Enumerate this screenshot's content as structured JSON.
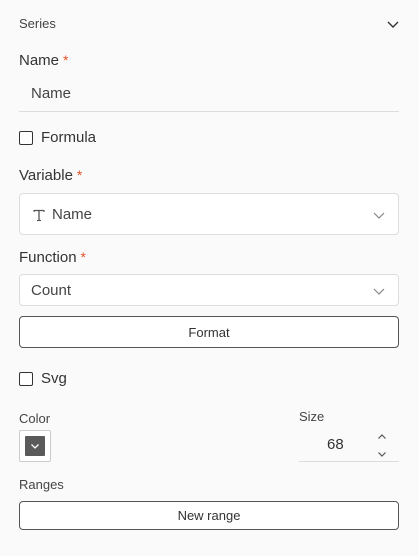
{
  "section": {
    "title": "Series"
  },
  "name": {
    "label": "Name",
    "required_mark": "*",
    "value": "Name"
  },
  "formula": {
    "label": "Formula",
    "checked": false
  },
  "variable": {
    "label": "Variable",
    "required_mark": "*",
    "type_icon": "text-type-icon",
    "value": "Name"
  },
  "function": {
    "label": "Function",
    "required_mark": "*",
    "value": "Count"
  },
  "format_button": {
    "label": "Format"
  },
  "svg": {
    "label": "Svg",
    "checked": false
  },
  "color": {
    "label": "Color",
    "value": "#5a5a5a"
  },
  "size": {
    "label": "Size",
    "value": "68"
  },
  "ranges": {
    "label": "Ranges",
    "new_button": "New range"
  },
  "colors": {
    "required": "#e0522c",
    "border": "#dddddd",
    "button_border": "#555555"
  }
}
